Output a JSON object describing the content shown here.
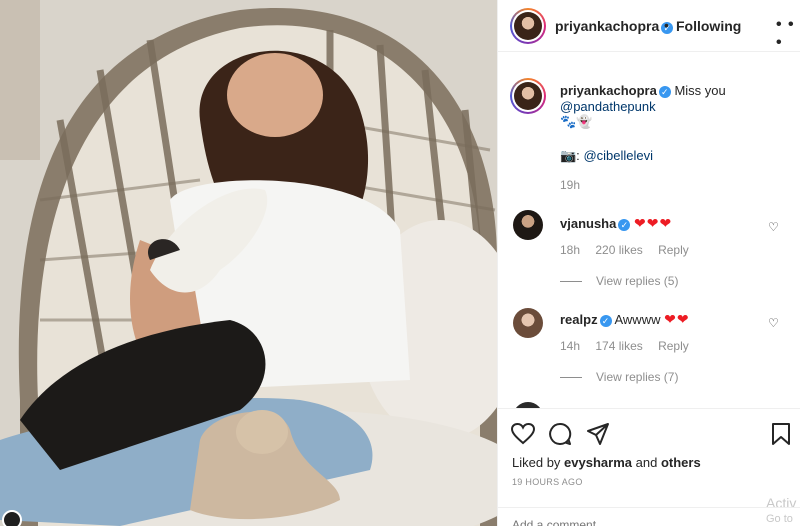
{
  "header": {
    "username": "priyankachopra",
    "separator": "•",
    "follow_status": "Following",
    "more_label": "• • •"
  },
  "caption": {
    "username": "priyankachopra",
    "text": "Miss you",
    "mention": "@pandathepunk",
    "emojis": "🐾👻",
    "camera_emoji": "📷:",
    "photo_credit": "@cibellelevi",
    "time": "19h"
  },
  "comments": [
    {
      "username": "vjanusha",
      "hearts": "❤❤❤",
      "time": "18h",
      "likes": "220 likes",
      "reply_label": "Reply",
      "view_replies": "View replies (5)"
    },
    {
      "username": "realpz",
      "text": "Awwww",
      "hearts": "❤❤",
      "time": "14h",
      "likes": "174 likes",
      "reply_label": "Reply",
      "view_replies": "View replies (7)"
    }
  ],
  "footer": {
    "liked_by_prefix": "Liked by",
    "liked_by_user": "evysharma",
    "liked_by_and": "and",
    "liked_by_others": "others",
    "post_time": "19 HOURS AGO",
    "add_comment_placeholder": "Add a comment...",
    "watermark_line1": "Activ",
    "watermark_line2": "Go to"
  },
  "colors": {
    "accent_blue": "#3897f0",
    "heart_red": "#ed1c24",
    "mention_blue": "#00376b",
    "muted_gray": "#8e8e8e"
  },
  "icons": [
    "verified-badge-icon",
    "like-heart-icon",
    "comment-icon",
    "share-icon",
    "bookmark-icon",
    "comment-like-icon",
    "more-options-icon"
  ]
}
